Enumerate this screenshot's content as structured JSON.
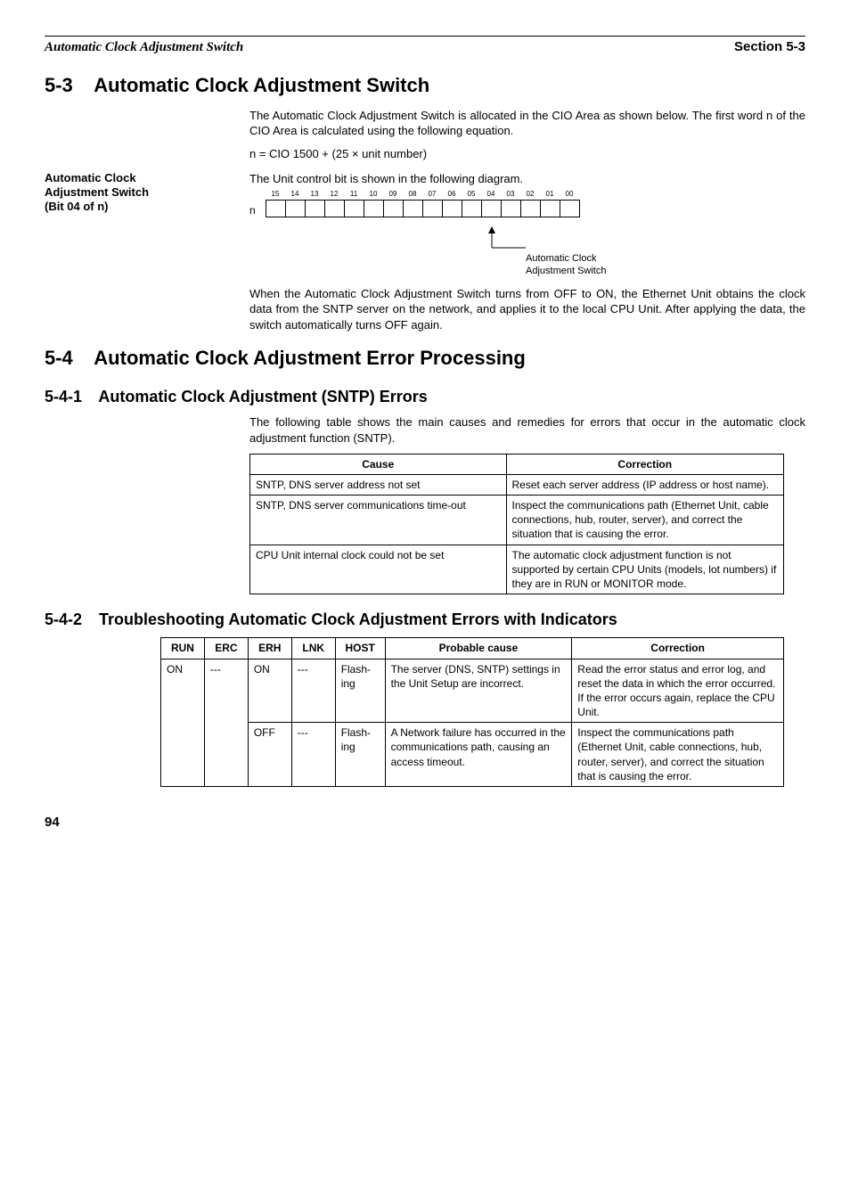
{
  "header": {
    "left": "Automatic Clock Adjustment Switch",
    "right": "Section 5-3"
  },
  "s53": {
    "num": "5-3",
    "title": "Automatic Clock Adjustment Switch",
    "p1": "The Automatic Clock Adjustment Switch is allocated in the CIO Area as shown below. The first word n of the CIO Area is calculated using the following equation.",
    "formula": "n = CIO 1500 + (25 × unit number)",
    "side_label_l1": "Automatic Clock",
    "side_label_l2": "Adjustment Switch",
    "side_label_l3": "(Bit 04 of n)",
    "p2": "The Unit control bit is shown in the following diagram.",
    "n_label": "n",
    "bits": [
      "15",
      "14",
      "13",
      "12",
      "11",
      "10",
      "09",
      "08",
      "07",
      "06",
      "05",
      "04",
      "03",
      "02",
      "01",
      "00"
    ],
    "pointer_l1": "Automatic Clock",
    "pointer_l2": "Adjustment Switch",
    "p3": "When the Automatic Clock Adjustment Switch turns from OFF to ON, the Ethernet Unit obtains the clock data from the SNTP server on the network, and applies it to the local CPU Unit. After applying the data, the switch automatically turns OFF again."
  },
  "s54": {
    "num": "5-4",
    "title": "Automatic Clock Adjustment Error Processing"
  },
  "s541": {
    "num": "5-4-1",
    "title": "Automatic Clock Adjustment (SNTP) Errors",
    "p1": "The following table shows the main causes and remedies for errors that occur in the automatic clock adjustment function (SNTP).",
    "th_cause": "Cause",
    "th_corr": "Correction",
    "rows": [
      {
        "cause": "SNTP, DNS server address not set",
        "corr": "Reset each server address (IP address or host name)."
      },
      {
        "cause": "SNTP, DNS server communications time-out",
        "corr": "Inspect the communications path (Ethernet Unit, cable connections, hub, router, server), and correct the situation that is causing the error."
      },
      {
        "cause": "CPU Unit internal clock could not be set",
        "corr": "The automatic clock adjustment function is not supported by certain CPU Units (models, lot numbers) if they are in RUN or MONITOR mode."
      }
    ]
  },
  "s542": {
    "num": "5-4-2",
    "title": "Troubleshooting Automatic Clock Adjustment Errors with Indicators",
    "th": {
      "run": "RUN",
      "erc": "ERC",
      "erh": "ERH",
      "lnk": "LNK",
      "host": "HOST",
      "probable": "Probable cause",
      "corr": "Correction"
    },
    "rows": [
      {
        "run": "ON",
        "erc": "---",
        "erh": "ON",
        "lnk": "---",
        "host": "Flash-ing",
        "probable": "The server (DNS, SNTP) settings in the Unit Setup are incorrect.",
        "corr": "Read the error status and error log, and reset the data in which the error occurred. If the error occurs again, replace the CPU Unit."
      },
      {
        "run": "",
        "erc": "",
        "erh": "OFF",
        "lnk": "---",
        "host": "Flash-ing",
        "probable": "A Network failure has occurred in the communications path, causing an access timeout.",
        "corr": "Inspect the communications path (Ethernet Unit, cable connections, hub, router, server), and correct the situation that is causing the error."
      }
    ]
  },
  "page_number": "94"
}
